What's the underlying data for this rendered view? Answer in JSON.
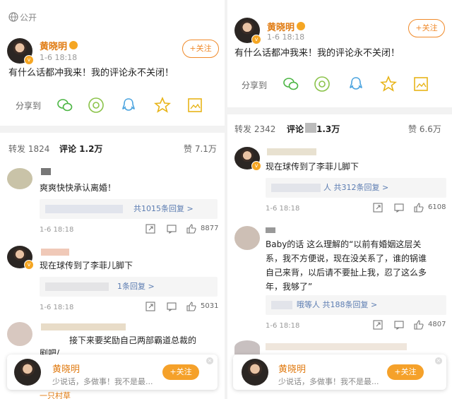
{
  "left": {
    "visibility_label": "公开",
    "author": {
      "name": "黄晓明",
      "time": "1-6 18:18",
      "follow_label": "+关注"
    },
    "post_text": "有什么话都冲我来！我的评论永不关闭！",
    "share_label": "分享到",
    "share_icons": [
      "wechat-icon",
      "moments-icon",
      "qq-icon",
      "qzone-star-icon",
      "save-image-icon"
    ],
    "tabs": {
      "repost": "转发 1824",
      "comment": "评论 1.2万",
      "like": "赞 7.1万"
    },
    "comments": [
      {
        "text": "爽爽快快承认离婚！",
        "replies": "共1015条回复 >",
        "time": "1-6 18:18",
        "likes": "8877"
      },
      {
        "text": "现在球传到了李菲儿脚下",
        "replies": "1条回复 >",
        "time": "1-6 18:18",
        "likes": "5031"
      },
      {
        "text_a": "接下来要奖励自己两部霸道总裁的",
        "text_b": "剧吧/"
      }
    ],
    "sticky": {
      "name": "黄晓明",
      "text": "少说话，多做事！我不是最...",
      "follow_label": "+关注"
    },
    "bottom_user": "一只村草"
  },
  "right": {
    "author": {
      "name": "黄晓明",
      "time": "1-6 18:18",
      "follow_label": "+关注"
    },
    "post_text": "有什么话都冲我来！我的评论永不关闭！",
    "share_label": "分享到",
    "tabs": {
      "repost": "转发 2342",
      "comment_a": "评论",
      "comment_b": "1.3万",
      "like": "赞 6.6万"
    },
    "comments": [
      {
        "text": "现在球传到了李菲儿脚下",
        "replies": "人 共312条回复 >",
        "time": "1-6 18:18",
        "likes": "6108"
      },
      {
        "lines": [
          "Baby的话 这么理解的“以前有婚姻这层关",
          "系，我不方便说，现在没关系了，谁的锅谁",
          "自己来背，以后请不要扯上我，忍了这么多",
          "年，我够了”"
        ],
        "replies": "哦等人 共188条回复 >",
        "time": "1-6 18:18",
        "likes": "4807"
      }
    ],
    "sticky": {
      "name": "黄晓明",
      "text": "少说话，多做事！我不是最...",
      "follow_label": "+关注"
    }
  }
}
